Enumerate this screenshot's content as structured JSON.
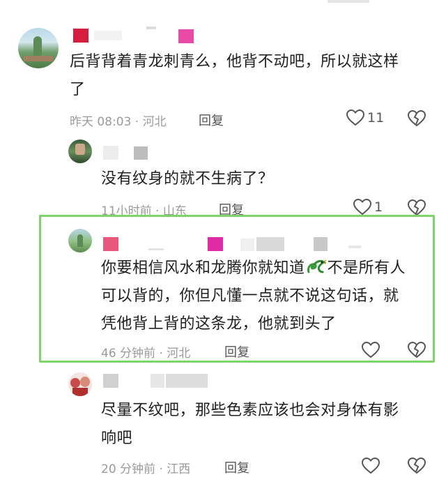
{
  "comments": [
    {
      "text_lines": [
        "后背背着青龙刺青么，他背不动吧，所以就这样",
        "了"
      ],
      "time": "昨天 08:03",
      "location": "河北",
      "reply_label": "回复",
      "likes": "11"
    },
    {
      "text_lines": [
        "没有纹身的就不生病了？"
      ],
      "time": "11小时前",
      "location": "山东",
      "reply_label": "回复",
      "likes": "1"
    },
    {
      "text_lines": [
        "你要相信风水和龙腾你就知道",
        "不是所有人",
        "可以背的，你但凡懂一点就不说这句话，就",
        "凭他背上背的这条龙，他就到头了"
      ],
      "emoji": "dragon-emoji",
      "time": "46 分钟前",
      "location": "河北",
      "reply_label": "回复",
      "likes": ""
    },
    {
      "text_lines": [
        "尽量不纹吧，那些色素应该也会对身体有影",
        "响吧"
      ],
      "time": "20 分钟前",
      "location": "江西",
      "reply_label": "回复",
      "likes": ""
    }
  ],
  "colors": {
    "highlight_border": "#7ed36a",
    "meta_text": "#9a9a9a"
  },
  "icons": [
    "heart-icon",
    "broken-heart-icon"
  ]
}
